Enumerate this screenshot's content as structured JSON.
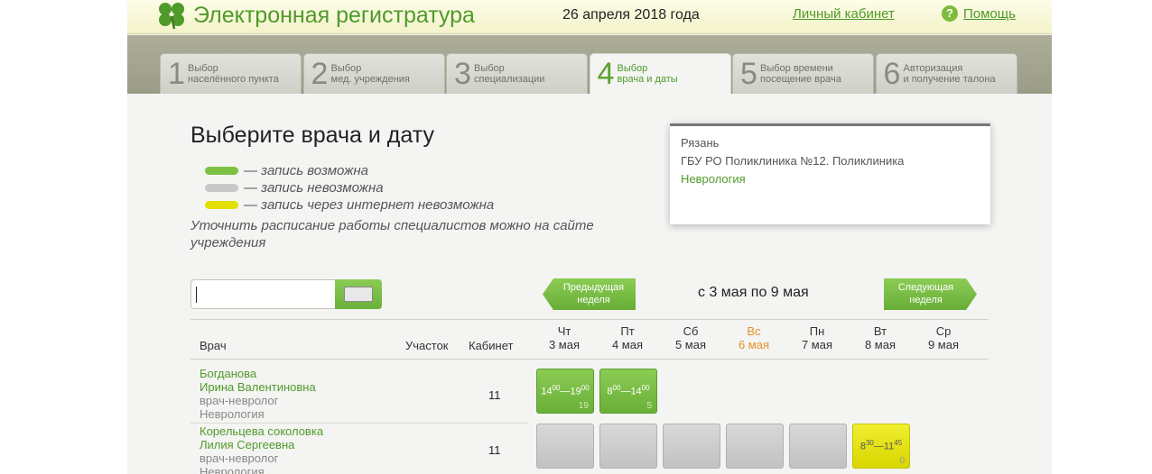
{
  "header": {
    "app_title": "Электронная регистратура",
    "date": "26 апреля 2018 года",
    "cabinet_link": "Личный кабинет",
    "help_link": "Помощь",
    "help_icon_glyph": "?",
    "logo_icon": "clover-icon",
    "accent_color": "#4f9a2a"
  },
  "steps": [
    {
      "num": "1",
      "line1": "Выбор",
      "line2": "населённого пункта",
      "active": false
    },
    {
      "num": "2",
      "line1": "Выбор",
      "line2": "мед. учреждения",
      "active": false
    },
    {
      "num": "3",
      "line1": "Выбор",
      "line2": "специализации",
      "active": false
    },
    {
      "num": "4",
      "line1": "Выбор",
      "line2": "врача и даты",
      "active": true
    },
    {
      "num": "5",
      "line1": "Выбор времени",
      "line2": "посещение врача",
      "active": false
    },
    {
      "num": "6",
      "line1": "Авторизация",
      "line2": "и получение талона",
      "active": false
    }
  ],
  "main": {
    "title": "Выберите врача и дату",
    "legend": [
      {
        "text": "— запись возможна",
        "color": "#7cc144"
      },
      {
        "text": "— запись невозможна",
        "color": "#c8c8c8"
      },
      {
        "text": "— запись через интернет невозможна",
        "color": "#e3e000"
      }
    ],
    "note": "Уточнить расписание работы специалистов можно на сайте учреждения"
  },
  "info_box": {
    "city": "Рязань",
    "institution": "ГБУ РО Поликлиника №12. Поликлиника",
    "specialization": "Неврология"
  },
  "search": {
    "value": "",
    "keyboard_icon": "keyboard-icon"
  },
  "week_nav": {
    "prev_label_1": "Предыдущая",
    "prev_label_2": "неделя",
    "range": "с 3 мая по 9 мая",
    "next_label_1": "Следующая",
    "next_label_2": "неделя"
  },
  "table": {
    "headers": {
      "doctor": "Врач",
      "section": "Участок",
      "cabinet": "Кабинет"
    },
    "days": [
      {
        "dow": "Чт",
        "date": "3 мая",
        "weekend": false
      },
      {
        "dow": "Пт",
        "date": "4 мая",
        "weekend": false
      },
      {
        "dow": "Сб",
        "date": "5 мая",
        "weekend": false
      },
      {
        "dow": "Вс",
        "date": "6 мая",
        "weekend": true
      },
      {
        "dow": "Пн",
        "date": "7 мая",
        "weekend": false
      },
      {
        "dow": "Вт",
        "date": "8 мая",
        "weekend": false
      },
      {
        "dow": "Ср",
        "date": "9 мая",
        "weekend": false
      }
    ],
    "rows": [
      {
        "surname": "Богданова",
        "name": "Ирина Валентиновна",
        "position": "врач-невролог",
        "department": "Неврология",
        "cabinet": "11",
        "slots": [
          {
            "day": 0,
            "state": "available",
            "start_h": "14",
            "start_m": "00",
            "end_h": "19",
            "end_m": "00",
            "count": "19"
          },
          {
            "day": 1,
            "state": "available",
            "start_h": "8",
            "start_m": "00",
            "end_h": "14",
            "end_m": "00",
            "count": "5"
          }
        ]
      },
      {
        "surname": "Корельцева соколовка",
        "name": "Лилия Сергеевна",
        "position": "врач-невролог",
        "department": "Неврология",
        "cabinet": "11",
        "slots": [
          {
            "day": 0,
            "state": "unavailable"
          },
          {
            "day": 1,
            "state": "unavailable"
          },
          {
            "day": 2,
            "state": "unavailable"
          },
          {
            "day": 3,
            "state": "unavailable"
          },
          {
            "day": 4,
            "state": "unavailable"
          },
          {
            "day": 5,
            "state": "no-internet",
            "start_h": "8",
            "start_m": "30",
            "end_h": "11",
            "end_m": "45",
            "count": "0"
          }
        ]
      }
    ]
  }
}
